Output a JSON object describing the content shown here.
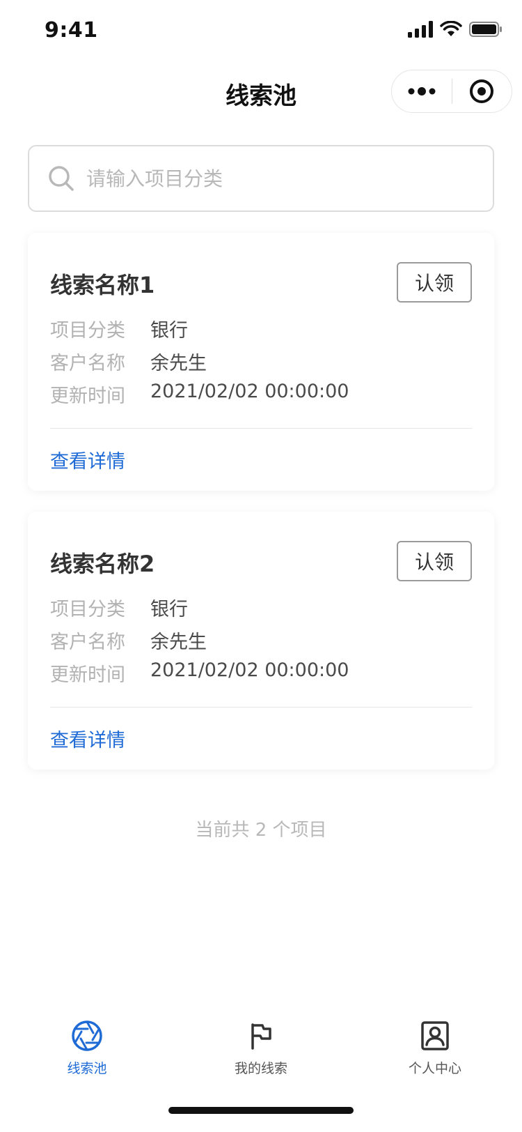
{
  "status_bar": {
    "time": "9:41"
  },
  "nav": {
    "title": "线索池"
  },
  "search": {
    "placeholder": "请输入项目分类",
    "value": ""
  },
  "cards": [
    {
      "title": "线索名称1",
      "claim_label": "认领",
      "rows": [
        {
          "label": "项目分类",
          "value": "银行"
        },
        {
          "label": "客户名称",
          "value": "余先生"
        },
        {
          "label": "更新时间",
          "value": "2021/02/02 00:00:00"
        }
      ],
      "detail_label": "查看详情"
    },
    {
      "title": "线索名称2",
      "claim_label": "认领",
      "rows": [
        {
          "label": "项目分类",
          "value": "银行"
        },
        {
          "label": "客户名称",
          "value": "余先生"
        },
        {
          "label": "更新时间",
          "value": "2021/02/02 00:00:00"
        }
      ],
      "detail_label": "查看详情"
    }
  ],
  "footer": {
    "count_text": "当前共 2 个项目"
  },
  "tabs": [
    {
      "label": "线索池",
      "icon": "aperture-icon",
      "active": true
    },
    {
      "label": "我的线索",
      "icon": "flag-icon",
      "active": false
    },
    {
      "label": "个人中心",
      "icon": "user-badge-icon",
      "active": false
    }
  ],
  "colors": {
    "accent": "#1f6bd6",
    "muted_text": "#b2b2b2",
    "text": "#333333"
  }
}
